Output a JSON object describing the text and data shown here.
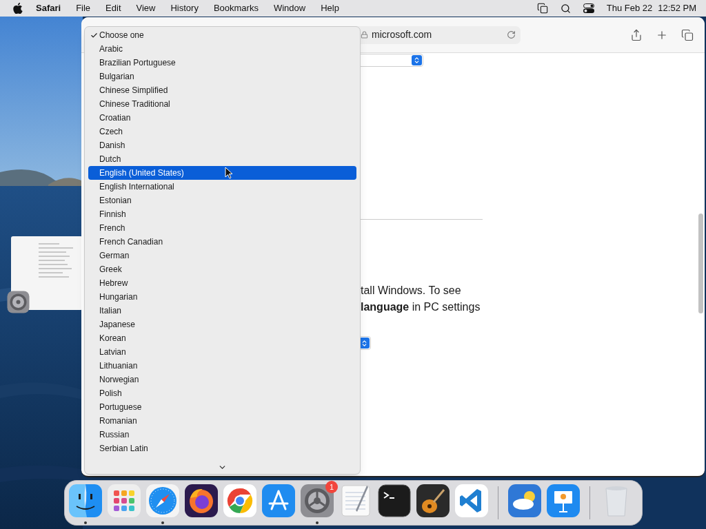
{
  "menu_bar": {
    "app": "Safari",
    "menus": [
      "File",
      "Edit",
      "View",
      "History",
      "Bookmarks",
      "Window",
      "Help"
    ],
    "date": "Thu Feb 22",
    "time": "12:52 PM"
  },
  "browser": {
    "address": "microsoft.com",
    "page_lines": [
      "tall Windows. To see",
      "**language** in PC settings"
    ]
  },
  "dropdown": {
    "options": [
      {
        "label": "Choose one",
        "checked": true,
        "selected": false
      },
      {
        "label": "Arabic",
        "checked": false,
        "selected": false
      },
      {
        "label": "Brazilian Portuguese",
        "checked": false,
        "selected": false
      },
      {
        "label": "Bulgarian",
        "checked": false,
        "selected": false
      },
      {
        "label": "Chinese Simplified",
        "checked": false,
        "selected": false
      },
      {
        "label": "Chinese Traditional",
        "checked": false,
        "selected": false
      },
      {
        "label": "Croatian",
        "checked": false,
        "selected": false
      },
      {
        "label": "Czech",
        "checked": false,
        "selected": false
      },
      {
        "label": "Danish",
        "checked": false,
        "selected": false
      },
      {
        "label": "Dutch",
        "checked": false,
        "selected": false
      },
      {
        "label": "English (United States)",
        "checked": false,
        "selected": true
      },
      {
        "label": "English International",
        "checked": false,
        "selected": false
      },
      {
        "label": "Estonian",
        "checked": false,
        "selected": false
      },
      {
        "label": "Finnish",
        "checked": false,
        "selected": false
      },
      {
        "label": "French",
        "checked": false,
        "selected": false
      },
      {
        "label": "French Canadian",
        "checked": false,
        "selected": false
      },
      {
        "label": "German",
        "checked": false,
        "selected": false
      },
      {
        "label": "Greek",
        "checked": false,
        "selected": false
      },
      {
        "label": "Hebrew",
        "checked": false,
        "selected": false
      },
      {
        "label": "Hungarian",
        "checked": false,
        "selected": false
      },
      {
        "label": "Italian",
        "checked": false,
        "selected": false
      },
      {
        "label": "Japanese",
        "checked": false,
        "selected": false
      },
      {
        "label": "Korean",
        "checked": false,
        "selected": false
      },
      {
        "label": "Latvian",
        "checked": false,
        "selected": false
      },
      {
        "label": "Lithuanian",
        "checked": false,
        "selected": false
      },
      {
        "label": "Norwegian",
        "checked": false,
        "selected": false
      },
      {
        "label": "Polish",
        "checked": false,
        "selected": false
      },
      {
        "label": "Portuguese",
        "checked": false,
        "selected": false
      },
      {
        "label": "Romanian",
        "checked": false,
        "selected": false
      },
      {
        "label": "Russian",
        "checked": false,
        "selected": false
      },
      {
        "label": "Serbian Latin",
        "checked": false,
        "selected": false
      }
    ]
  },
  "dock": {
    "apps": [
      {
        "kind": "finder",
        "running": true
      },
      {
        "kind": "launchpad",
        "running": false
      },
      {
        "kind": "safari",
        "running": true
      },
      {
        "kind": "firefox",
        "running": false
      },
      {
        "kind": "chrome",
        "running": false
      },
      {
        "kind": "appstore",
        "running": false
      },
      {
        "kind": "settings",
        "running": true,
        "badge": "1"
      },
      {
        "kind": "textedit",
        "running": false
      },
      {
        "kind": "terminal",
        "running": false
      },
      {
        "kind": "garageband",
        "running": false
      },
      {
        "kind": "vscode",
        "running": false
      },
      {
        "kind": "separator"
      },
      {
        "kind": "weather",
        "running": false
      },
      {
        "kind": "keynote",
        "running": false
      },
      {
        "kind": "separator"
      },
      {
        "kind": "trash",
        "running": false
      }
    ]
  }
}
